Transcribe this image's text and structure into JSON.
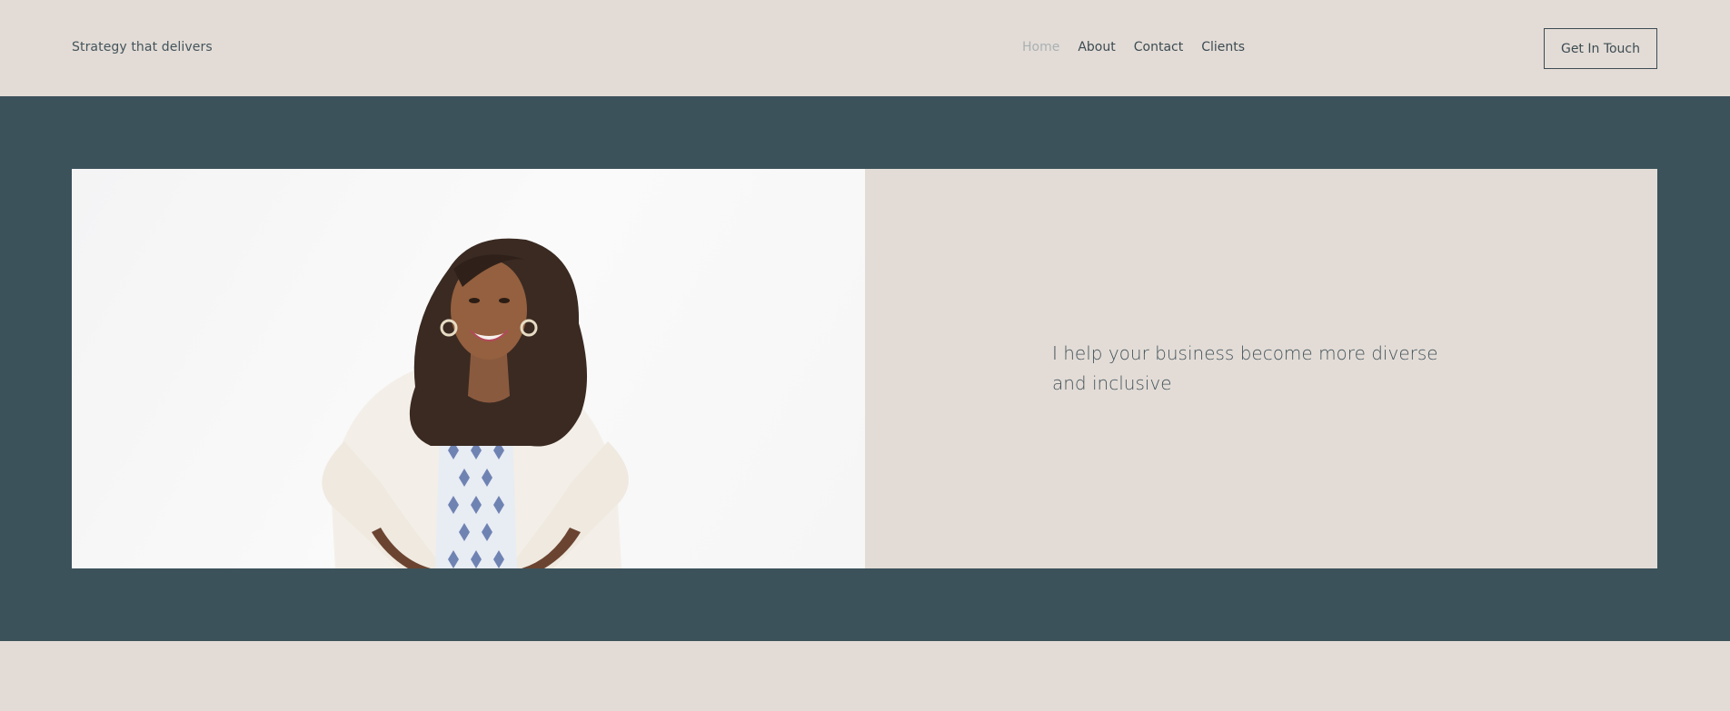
{
  "header": {
    "tagline": "Strategy that delivers",
    "nav": [
      {
        "label": "Home",
        "active": true
      },
      {
        "label": "About",
        "active": false
      },
      {
        "label": "Contact",
        "active": false
      },
      {
        "label": "Clients",
        "active": false
      }
    ],
    "cta_label": "Get In Touch"
  },
  "hero": {
    "headline": "I help your business become more diverse and inclusive",
    "image": "portrait-photo"
  },
  "colors": {
    "background": "#e3dcd6",
    "band": "#3c525b",
    "text": "#3d4b52",
    "nav_active": "#a9b0b4"
  }
}
